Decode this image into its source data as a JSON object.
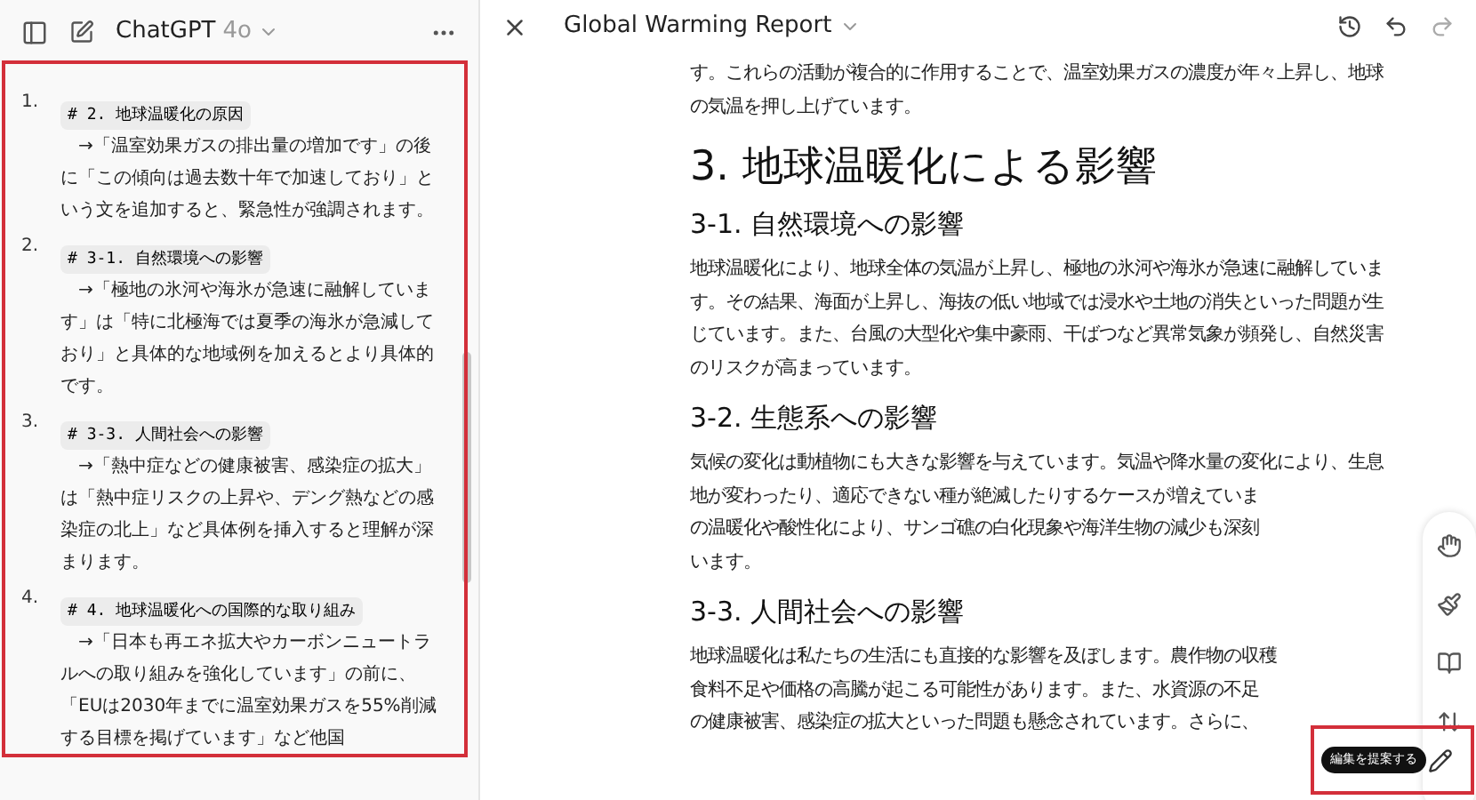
{
  "sidebar": {
    "app_name": "ChatGPT",
    "model": "4o",
    "items": [
      {
        "number": "1.",
        "heading": "# 2. 地球温暖化の原因",
        "text": "→「温室効果ガスの排出量の増加です」の後に「この傾向は過去数十年で加速しており」という文を追加すると、緊急性が強調されます。"
      },
      {
        "number": "2.",
        "heading": "# 3-1. 自然環境への影響",
        "text": "→「極地の氷河や海氷が急速に融解しています」は「特に北極海では夏季の海氷が急減しており」と具体的な地域例を加えるとより具体的です。"
      },
      {
        "number": "3.",
        "heading": "# 3-3. 人間社会への影響",
        "text": "→「熱中症などの健康被害、感染症の拡大」は「熱中症リスクの上昇や、デング熱などの感染症の北上」など具体例を挿入すると理解が深まります。"
      },
      {
        "number": "4.",
        "heading": "# 4. 地球温暖化への国際的な取り組み",
        "text": "→「日本も再エネ拡大やカーボンニュートラルへの取り組みを強化しています」の前に、「EUは2030年までに温室効果ガスを55%削減する目標を掲げています」など他国"
      }
    ]
  },
  "document": {
    "title": "Global Warming Report",
    "blocks": [
      {
        "kind": "paragraph",
        "lines": [
          "す。これらの活動が複合的に作用することで、温室効果ガスの濃度が年々上昇し、地球",
          "の気温を押し上げています。"
        ]
      },
      {
        "kind": "h1",
        "text": "3. 地球温暖化による影響"
      },
      {
        "kind": "h2",
        "text": "3-1. 自然環境への影響"
      },
      {
        "kind": "paragraph",
        "lines": [
          "地球温暖化により、地球全体の気温が上昇し、極地の氷河や海氷が急速に融解していま",
          "す。その結果、海面が上昇し、海抜の低い地域では浸水や土地の消失といった問題が生",
          "じています。また、台風の大型化や集中豪雨、干ばつなど異常気象が頻発し、自然災害",
          "のリスクが高まっています。"
        ]
      },
      {
        "kind": "h2",
        "text": "3-2. 生態系への影響"
      },
      {
        "kind": "paragraph",
        "lines": [
          "気候の変化は動植物にも大きな影響を与えています。気温や降水量の変化により、生息",
          "地が変わったり、適応できない種が絶滅したりするケースが増えていま",
          "の温暖化や酸性化により、サンゴ礁の白化現象や海洋生物の減少も深刻",
          "います。"
        ]
      },
      {
        "kind": "h2",
        "text": "3-3. 人間社会への影響"
      },
      {
        "kind": "paragraph",
        "lines": [
          "地球温暖化は私たちの生活にも直接的な影響を及ぼします。農作物の収穫",
          "食料不足や価格の高騰が起こる可能性があります。また、水資源の不足",
          "の健康被害、感染症の拡大といった問題も懸念されています。さらに、"
        ]
      }
    ]
  },
  "toolbar": {
    "tooltip": "編集を提案する"
  }
}
